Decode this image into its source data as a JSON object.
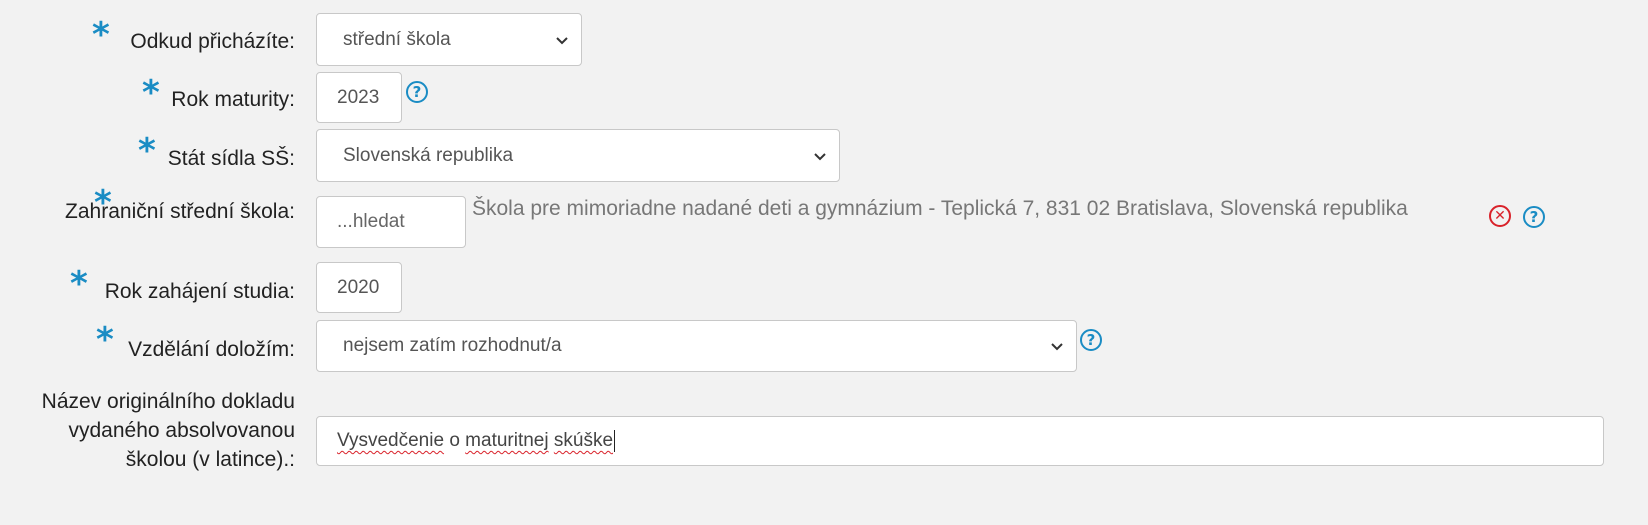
{
  "form": {
    "origin": {
      "label": "Odkud přicházíte:",
      "value": "střední škola"
    },
    "graduation_year": {
      "label": "Rok maturity:",
      "value": "2023",
      "help": "?"
    },
    "school_country": {
      "label": "Stát sídla SŠ:",
      "value": "Slovenská republika"
    },
    "foreign_school": {
      "label": "Zahraniční střední škola:",
      "placeholder": "...hledat",
      "selected": "Škola pre mimoriadne nadané deti a gymnázium - Teplická 7, 831 02 Bratislava, Slovenská republika",
      "help": "?"
    },
    "study_start_year": {
      "label": "Rok zahájení studia:",
      "value": "2020"
    },
    "education_proof": {
      "label": "Vzdělání doložím:",
      "value": "nejsem zatím rozhodnut/a",
      "help": "?"
    },
    "original_document": {
      "label": "Název originálního dokladu vydaného absolvovanou školou (v latince).:",
      "value_parts": [
        "Vysvedčenie",
        "o",
        "maturitnej",
        "skúške"
      ]
    },
    "required_mark": "*",
    "remove_icon": "close-circle-icon",
    "accent_color": "#1a8cc4",
    "error_color": "#d9222a"
  }
}
